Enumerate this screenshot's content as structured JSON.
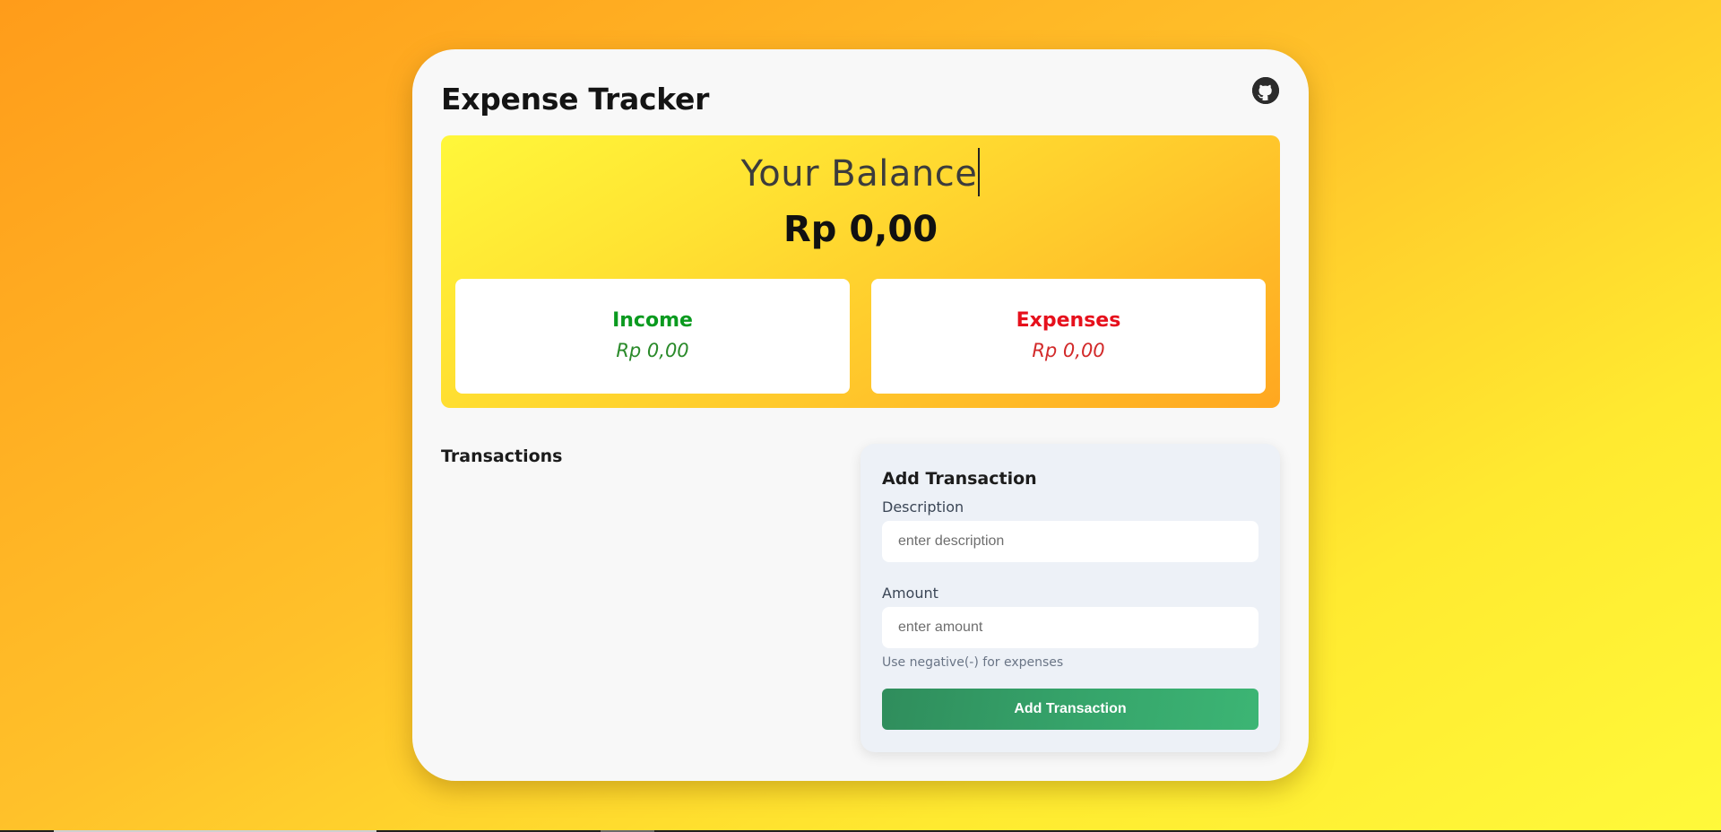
{
  "app": {
    "title": "Expense Tracker",
    "github_icon": "github-icon"
  },
  "balance": {
    "label": "Your Balance",
    "amount": "Rp 0,00"
  },
  "income": {
    "label": "Income",
    "amount": "Rp 0,00",
    "color": "#0a9a1f"
  },
  "expenses": {
    "label": "Expenses",
    "amount": "Rp 0,00",
    "color": "#e6101c"
  },
  "transactions": {
    "heading": "Transactions",
    "items": []
  },
  "form": {
    "title": "Add Transaction",
    "description_label": "Description",
    "description_placeholder": "enter description",
    "description_value": "",
    "amount_label": "Amount",
    "amount_placeholder": "enter amount",
    "amount_value": "",
    "hint": "Use negative(-) for expenses",
    "submit_label": "Add Transaction",
    "submit_color": "#36a56b"
  },
  "theme": {
    "background_start": "#ff9c1a",
    "background_end": "#fff93a"
  }
}
